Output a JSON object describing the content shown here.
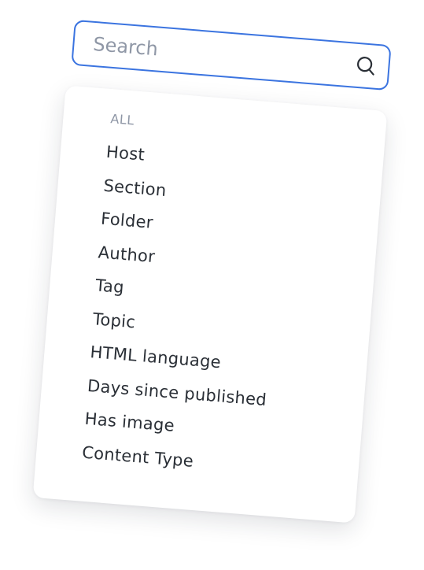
{
  "search": {
    "placeholder": "Search",
    "value": "",
    "icon": "search-icon",
    "border_color": "#3b74e0"
  },
  "dropdown": {
    "section_label": "ALL",
    "options": [
      "Host",
      "Section",
      "Folder",
      "Author",
      "Tag",
      "Topic",
      "HTML language",
      "Days since published",
      "Has image",
      "Content Type"
    ]
  }
}
